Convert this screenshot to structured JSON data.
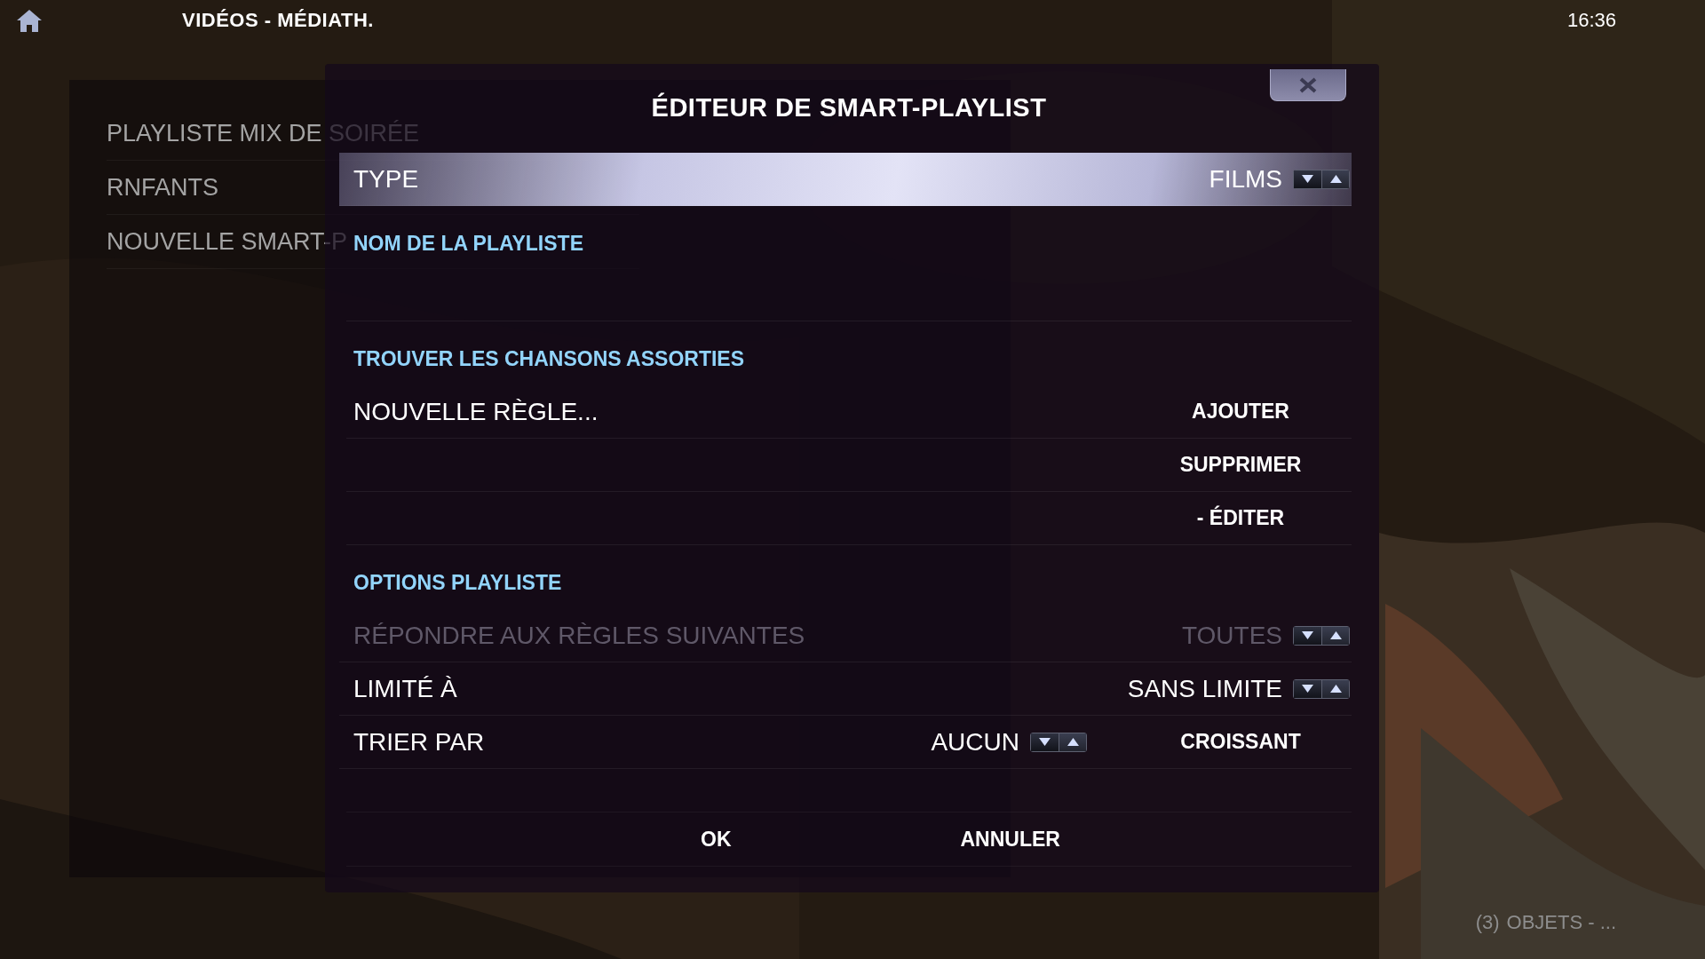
{
  "header": {
    "title": "VIDÉOS - MÉDIATH.",
    "clock": "16:36"
  },
  "playlists": [
    {
      "label": "PLAYLISTE MIX DE SOIRÉE"
    },
    {
      "label": "RNFANTS"
    },
    {
      "label": "NOUVELLE SMART-P"
    }
  ],
  "dialog": {
    "title": "ÉDITEUR DE SMART-PLAYLIST",
    "rows": [
      {
        "kind": "spinner",
        "label": "TYPE",
        "value": "FILMS",
        "focused": true,
        "disabled": false
      },
      {
        "kind": "heading",
        "label": "NOM DE LA PLAYLISTE"
      },
      {
        "kind": "blank"
      },
      {
        "kind": "heading",
        "label": "TROUVER LES CHANSONS ASSORTIES"
      },
      {
        "kind": "rule",
        "label": "NOUVELLE RÈGLE...",
        "button": "AJOUTER"
      },
      {
        "kind": "action",
        "button": "SUPPRIMER"
      },
      {
        "kind": "action",
        "button": "- ÉDITER"
      },
      {
        "kind": "heading",
        "label": "OPTIONS PLAYLISTE"
      },
      {
        "kind": "spinner",
        "label": "RÉPONDRE AUX RÈGLES SUIVANTES",
        "value": "TOUTES",
        "focused": false,
        "disabled": true
      },
      {
        "kind": "spinner",
        "label": "LIMITÉ À",
        "value": "SANS LIMITE",
        "focused": false,
        "disabled": false
      },
      {
        "kind": "sort",
        "label": "TRIER PAR",
        "value": "AUCUN",
        "button": "CROISSANT"
      }
    ],
    "buttons": [
      "OK",
      "ANNULER"
    ]
  },
  "status": {
    "count": "(3)",
    "text": "OBJETS - ..."
  }
}
